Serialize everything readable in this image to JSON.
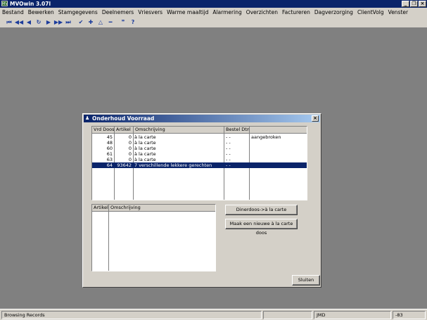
{
  "app": {
    "title": "MVOwin 3.07l",
    "icon_label": "MV"
  },
  "menu": [
    "Bestand",
    "Bewerken",
    "Stamgegevens",
    "Deelnemers",
    "Vriesvers",
    "Warme maaltijd",
    "Alarmering",
    "Overzichten",
    "Factureren",
    "Dagverzorging",
    "ClientVolg",
    "Venster"
  ],
  "toolbar": {
    "icons": [
      {
        "name": "first-record-icon",
        "glyph": "⏮"
      },
      {
        "name": "prev-page-icon",
        "glyph": "◀◀"
      },
      {
        "name": "prev-record-icon",
        "glyph": "◀"
      },
      {
        "name": "refresh-icon",
        "glyph": "↻"
      },
      {
        "name": "next-record-icon",
        "glyph": "▶"
      },
      {
        "name": "next-page-icon",
        "glyph": "▶▶"
      },
      {
        "name": "last-record-icon",
        "glyph": "⏭"
      },
      {
        "name": "confirm-icon",
        "glyph": "✔"
      },
      {
        "name": "add-icon",
        "glyph": "✚"
      },
      {
        "name": "edit-icon",
        "glyph": "△"
      },
      {
        "name": "delete-icon",
        "glyph": "━"
      },
      {
        "name": "quote-icon",
        "glyph": "❞"
      },
      {
        "name": "help-icon",
        "glyph": "?"
      }
    ]
  },
  "dialog": {
    "title": "Onderhoud Voorraad",
    "close_glyph": "×",
    "top_grid": {
      "headers": [
        "Vrd Doos",
        "Artikel",
        "Omschrijving",
        "Bestel Dtm",
        ""
      ],
      "rows": [
        {
          "vrd_doos": "45",
          "artikel": "0",
          "omschrijving": "à la carte",
          "bestel_dtm": " - -",
          "extra": "aangebroken",
          "selected": false
        },
        {
          "vrd_doos": "48",
          "artikel": "0",
          "omschrijving": "à la carte",
          "bestel_dtm": " - -",
          "extra": "",
          "selected": false
        },
        {
          "vrd_doos": "60",
          "artikel": "0",
          "omschrijving": "à la carte",
          "bestel_dtm": " - -",
          "extra": "",
          "selected": false
        },
        {
          "vrd_doos": "61",
          "artikel": "0",
          "omschrijving": "à la carte",
          "bestel_dtm": " - -",
          "extra": "",
          "selected": false
        },
        {
          "vrd_doos": "63",
          "artikel": "0",
          "omschrijving": "à la carte",
          "bestel_dtm": " - -",
          "extra": "",
          "selected": false
        },
        {
          "vrd_doos": "64",
          "artikel": "93642",
          "omschrijving": "7 verschillende lekkere gerechten",
          "bestel_dtm": " - -",
          "extra": "",
          "selected": true
        }
      ]
    },
    "bottom_grid": {
      "headers": [
        "Artikel",
        "Omschrijving"
      ]
    },
    "buttons": {
      "dinerdoos": "Dinerdoos->à la carte",
      "maak_nieuwe": "Maak een nieuwe à la carte doos",
      "sluiten": "Sluiten"
    }
  },
  "status": {
    "mode": "Browsing Records",
    "user": "JMD",
    "code": "-83"
  }
}
